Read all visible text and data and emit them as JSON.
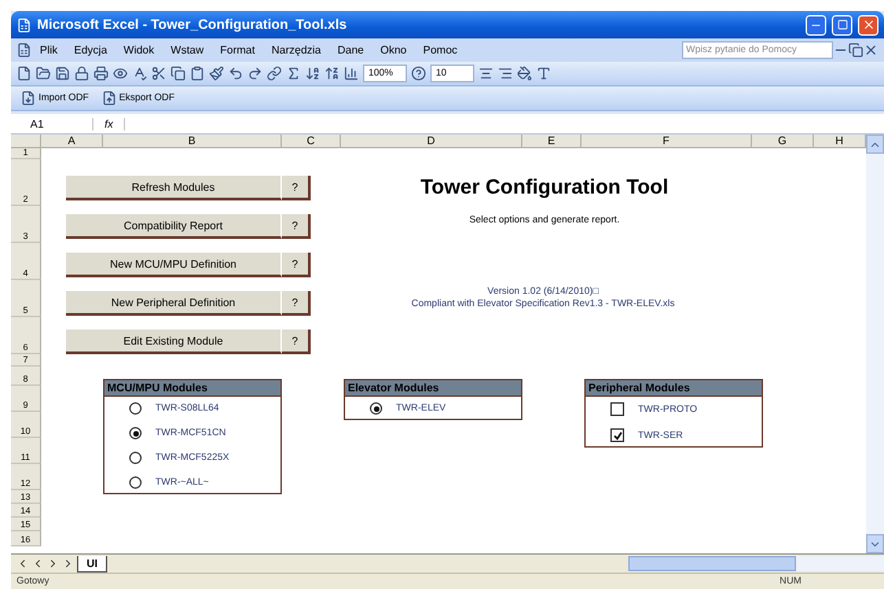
{
  "window": {
    "title": "Microsoft Excel - Tower_Configuration_Tool.xls"
  },
  "menu": [
    "Plik",
    "Edycja",
    "Widok",
    "Wstaw",
    "Format",
    "Narzędzia",
    "Dane",
    "Okno",
    "Pomoc"
  ],
  "help_search": {
    "placeholder": "Wpisz pytanie do Pomocy"
  },
  "toolbar": {
    "zoom": "100%",
    "font_size": "10"
  },
  "custom_toolbar": [
    "Import ODF",
    "Eksport ODF"
  ],
  "formula_bar": {
    "name_box": "A1",
    "fx": "fx"
  },
  "columns": [
    "A",
    "B",
    "C",
    "D",
    "E",
    "F",
    "G",
    "H"
  ],
  "rows": [
    "1",
    "2",
    "3",
    "4",
    "5",
    "6",
    "7",
    "8",
    "9",
    "10",
    "11",
    "12",
    "13",
    "14",
    "15",
    "16"
  ],
  "buttons": [
    {
      "label": "Refresh Modules",
      "help": "?"
    },
    {
      "label": "Compatibility Report",
      "help": "?"
    },
    {
      "label": "New MCU/MPU Definition",
      "help": "?"
    },
    {
      "label": "New Peripheral Definition",
      "help": "?"
    },
    {
      "label": "Edit Existing Module",
      "help": "?"
    }
  ],
  "heading": {
    "title": "Tower Configuration Tool",
    "subtitle": "Select options and generate report.",
    "version": "Version 1.02 (6/14/2010)□",
    "compliance": "Compliant with Elevator Specification Rev1.3 - TWR-ELEV.xls"
  },
  "panels": [
    {
      "title": "MCU/MPU Modules",
      "kind": "radio",
      "options": [
        {
          "label": "TWR-S08LL64",
          "selected": false
        },
        {
          "label": "TWR-MCF51CN",
          "selected": true
        },
        {
          "label": "TWR-MCF5225X",
          "selected": false
        },
        {
          "label": "TWR-~ALL~",
          "selected": false
        }
      ]
    },
    {
      "title": "Elevator Modules",
      "kind": "radio",
      "options": [
        {
          "label": "TWR-ELEV",
          "selected": true
        }
      ]
    },
    {
      "title": "Peripheral Modules",
      "kind": "checkbox",
      "options": [
        {
          "label": "TWR-PROTO",
          "selected": false
        },
        {
          "label": "TWR-SER",
          "selected": true
        }
      ]
    }
  ],
  "sheet_tabs": [
    {
      "label": "UI",
      "selected": true
    }
  ],
  "status_bar": {
    "left": "Gotowy",
    "indicator": "NUM"
  }
}
